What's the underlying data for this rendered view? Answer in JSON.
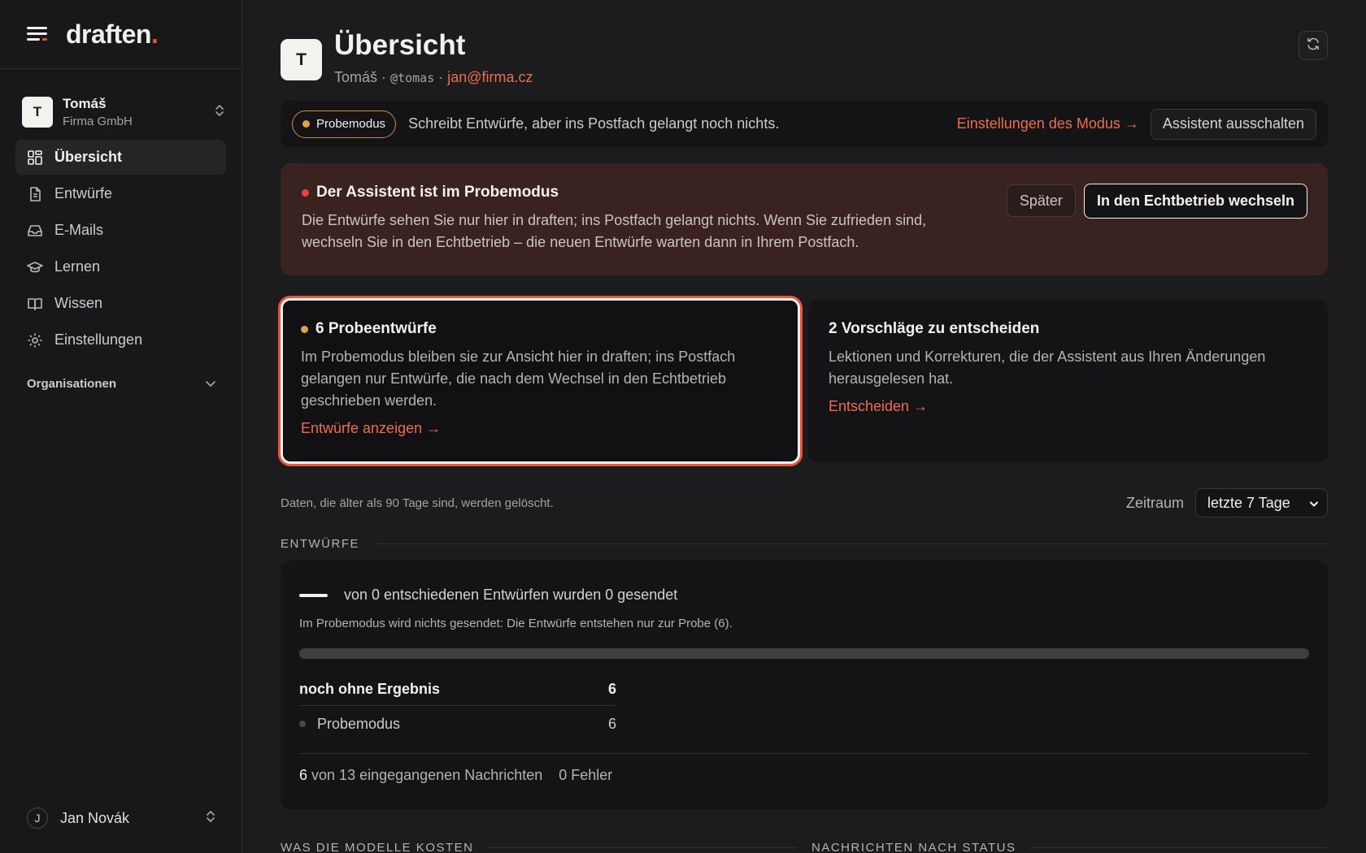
{
  "brand": {
    "name": "draften",
    "dot": "."
  },
  "account": {
    "initial": "T",
    "name": "Tomáš",
    "org": "Firma GmbH"
  },
  "nav": {
    "items": [
      {
        "label": "Übersicht",
        "icon": "grid-icon"
      },
      {
        "label": "Entwürfe",
        "icon": "document-icon"
      },
      {
        "label": "E-Mails",
        "icon": "inbox-icon"
      },
      {
        "label": "Lernen",
        "icon": "graduation-cap-icon"
      },
      {
        "label": "Wissen",
        "icon": "book-icon"
      },
      {
        "label": "Einstellungen",
        "icon": "gear-icon"
      }
    ],
    "section_label": "Organisationen"
  },
  "user": {
    "initial": "J",
    "name": "Jan Novák"
  },
  "header": {
    "initial": "T",
    "title": "Übersicht",
    "name": "Tomáš",
    "sep": "·",
    "handle": "@tomas",
    "email": "jan@firma.cz"
  },
  "modebar": {
    "pill": "Probemodus",
    "text": "Schreibt Entwürfe, aber ins Postfach gelangt noch nichts.",
    "settings_link": "Einstellungen des Modus →",
    "disable_button": "Assistent ausschalten"
  },
  "alert": {
    "title": "Der Assistent ist im Probemodus",
    "body": "Die Entwürfe sehen Sie nur hier in draften; ins Postfach gelangt nichts. Wenn Sie zufrieden sind, wechseln Sie in den Echtbetrieb – die neuen Entwürfe warten dann in Ihrem Postfach.",
    "later_button": "Später",
    "switch_button": "In den Echtbetrieb wechseln"
  },
  "cards": [
    {
      "title": "6 Probeentwürfe",
      "body": "Im Probemodus bleiben sie zur Ansicht hier in draften; ins Postfach gelangen nur Entwürfe, die nach dem Wechsel in den Echtbetrieb geschrieben werden.",
      "link": "Entwürfe anzeigen →"
    },
    {
      "title": "2 Vorschläge zu entscheiden",
      "body": "Lektionen und Korrekturen, die der Assistent aus Ihren Änderungen herausgelesen hat.",
      "link": "Entscheiden →"
    }
  ],
  "retention": {
    "note": "Daten, die älter als 90 Tage sind, werden gelöscht.",
    "period_label": "Zeitraum",
    "period_value": "letzte 7 Tage"
  },
  "drafts": {
    "section_label": "ENTWÜRFE",
    "headline": "von 0 entschiedenen Entwürfen wurden 0 gesendet",
    "hint": "Im Probemodus wird nichts gesendet: Die Entwürfe entstehen nur zur Probe (6).",
    "progress_fraction": 0,
    "rows": [
      {
        "label": "noch ohne Ergebnis",
        "value": "6"
      },
      {
        "label": "Probemodus",
        "value": "6"
      }
    ],
    "footer_count": "6",
    "footer_text": "von 13 eingegangenen Nachrichten",
    "footer_errors": "0 Fehler"
  },
  "bottom": {
    "left_label": "WAS DIE MODELLE KOSTEN",
    "right_label": "NACHRICHTEN NACH STATUS"
  },
  "colors": {
    "accent": "#ee6d4d",
    "amber": "#e0a145",
    "red": "#e8453b",
    "alert_bg": "#3a2220"
  }
}
